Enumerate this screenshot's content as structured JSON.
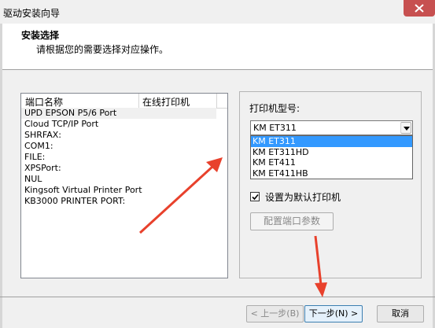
{
  "window": {
    "title": "驱动安装向导"
  },
  "header": {
    "title": "安装选择",
    "subtitle": "请根据您的需要选择对应操作。"
  },
  "port_list": {
    "columns": [
      "端口名称",
      "在线打印机"
    ],
    "rows": [
      "UPD EPSON P5/6 Port",
      "Cloud TCP/IP Port",
      "SHRFAX:",
      "COM1:",
      "FILE:",
      "XPSPort:",
      "NUL",
      "Kingsoft Virtual Printer Port",
      "KB3000 PRINTER PORT:"
    ],
    "selected_index": 0
  },
  "model": {
    "label": "打印机型号:",
    "selected": "KM ET311",
    "options": [
      "KM ET311",
      "KM ET311HD",
      "KM ET411",
      "KM ET411HB"
    ],
    "highlighted_index": 0
  },
  "default_printer": {
    "label": "设置为默认打印机",
    "checked": true
  },
  "config_button": {
    "label": "配置端口参数"
  },
  "footer": {
    "back": "< 上一步(B)",
    "next": "下一步(N) >",
    "cancel": "取消"
  },
  "colors": {
    "highlight": "#3399ff",
    "arrow": "#e8412c",
    "close": "#c75050"
  }
}
